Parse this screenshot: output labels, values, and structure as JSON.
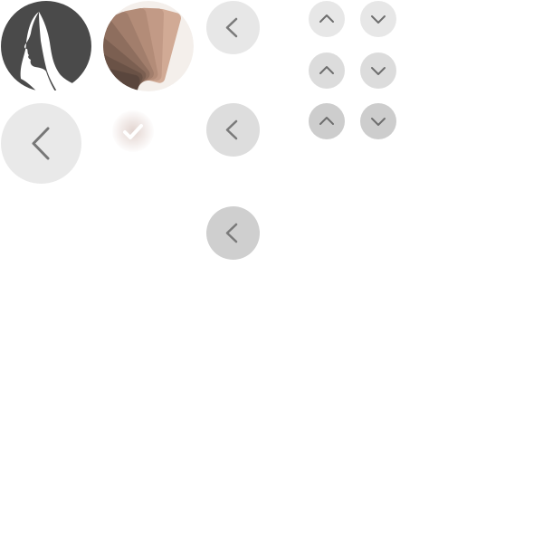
{
  "colors": {
    "avatar_bg": "#4a4a4a",
    "avatar_silhouette": "#ffffff",
    "button_light": "#e7e7e7",
    "button_medium": "#dcdcdc",
    "button_dark": "#cdcdcd",
    "chevron": "#7a7a7a",
    "check": "#ffffff",
    "swatch_shades": [
      "#5a463d",
      "#6a5246",
      "#7b5f51",
      "#8e6e5e",
      "#a27e6c",
      "#b38c78",
      "#c29a86",
      "#d1aa95"
    ]
  },
  "icons": {
    "avatar": "woman-profile-icon",
    "swatch": "color-fan-swatch-icon",
    "check": "checkmark-icon",
    "back": "chevron-left-icon",
    "up": "chevron-up-icon",
    "down": "chevron-down-icon"
  },
  "button_states": [
    "normal",
    "hover",
    "pressed"
  ]
}
